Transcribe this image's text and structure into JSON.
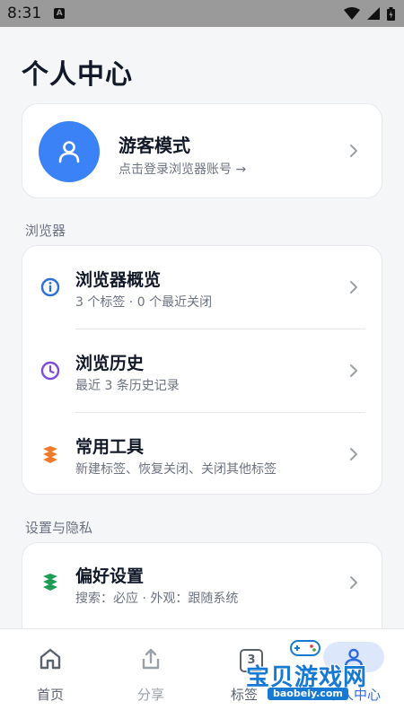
{
  "status_bar": {
    "time": "8:31",
    "notification_letter": "A"
  },
  "page": {
    "title": "个人中心"
  },
  "profile": {
    "name": "游客模式",
    "hint": "点击登录浏览器账号 →"
  },
  "sections": {
    "browser_label": "浏览器",
    "settings_label": "设置与隐私"
  },
  "browser_items": [
    {
      "title": "浏览器概览",
      "subtitle": "3 个标签 · 0 个最近关闭",
      "icon": "info-icon",
      "color": "#2f6fd6"
    },
    {
      "title": "浏览历史",
      "subtitle": "最近 3 条历史记录",
      "icon": "clock-icon",
      "color": "#7c4ddb"
    },
    {
      "title": "常用工具",
      "subtitle": "新建标签、恢复关闭、关闭其他标签",
      "icon": "tools-icon",
      "color": "#f07a2a"
    }
  ],
  "settings_items": [
    {
      "title": "偏好设置",
      "subtitle": "搜索：必应 · 外观：跟随系统",
      "icon": "preferences-icon",
      "color": "#1f9d55"
    }
  ],
  "bottom_nav": {
    "home": "首页",
    "share": "分享",
    "tabs": "标签",
    "tabs_count": "3",
    "profile": "个人中心"
  },
  "watermark": {
    "text": "宝贝游戏网",
    "url": "baobeiy.com"
  },
  "colors": {
    "accent": "#2d6bde",
    "avatar_bg": "#3b82f6",
    "background": "#f5f6f8"
  }
}
